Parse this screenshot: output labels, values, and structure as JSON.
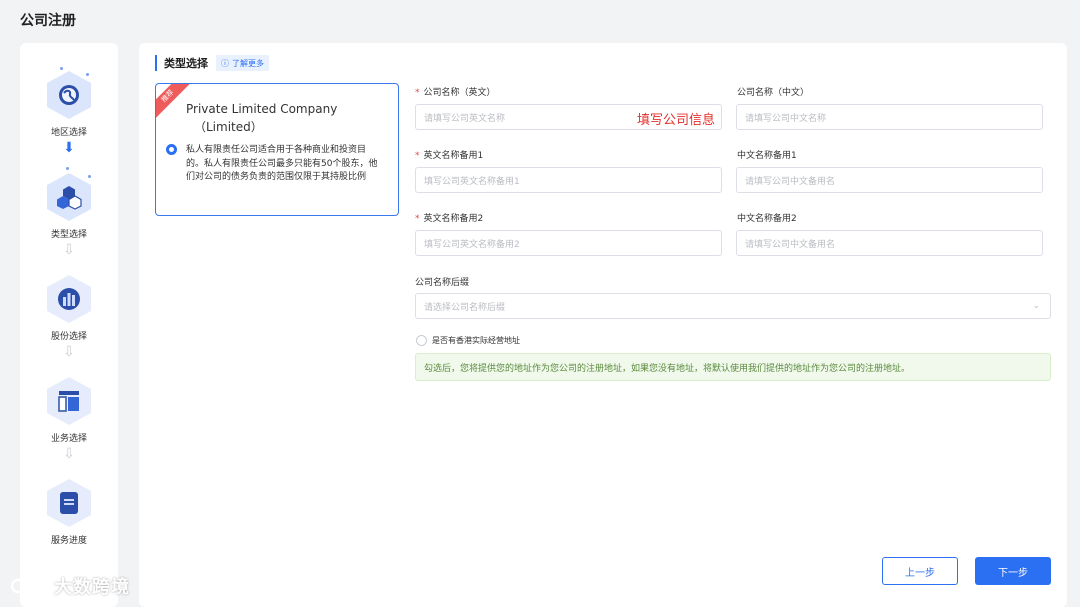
{
  "page_title": "公司注册",
  "steps": [
    {
      "label": "地区选择",
      "icon": "globe-icon",
      "state": "done"
    },
    {
      "label": "类型选择",
      "icon": "cubes-icon",
      "state": "active"
    },
    {
      "label": "股份选择",
      "icon": "bar-chart-icon",
      "state": "pending"
    },
    {
      "label": "业务选择",
      "icon": "layout-icon",
      "state": "pending"
    },
    {
      "label": "服务进度",
      "icon": "document-icon",
      "state": "pending"
    }
  ],
  "section": {
    "title": "类型选择",
    "learn_more": "了解更多"
  },
  "company_type": {
    "badge": "推荐",
    "title": "Private Limited Company",
    "subtitle": "（Limited）",
    "description": "私人有限责任公司适合用于各种商业和投资目的。私人有限责任公司最多只能有50个股东，他们对公司的债务负责的范围仅限于其持股比例",
    "selected": true
  },
  "form": {
    "name_en": {
      "label": "公司名称（英文）",
      "required": true,
      "placeholder": "请填写公司英文名称",
      "annotation": "填写公司信息"
    },
    "name_cn": {
      "label": "公司名称（中文）",
      "required": false,
      "placeholder": "请填写公司中文名称"
    },
    "alt_en_1": {
      "label": "英文名称备用1",
      "required": true,
      "placeholder": "填写公司英文名称备用1"
    },
    "alt_cn_1": {
      "label": "中文名称备用1",
      "required": false,
      "placeholder": "请填写公司中文备用名"
    },
    "alt_en_2": {
      "label": "英文名称备用2",
      "required": true,
      "placeholder": "填写公司英文名称备用2"
    },
    "alt_cn_2": {
      "label": "中文名称备用2",
      "required": false,
      "placeholder": "请填写公司中文备用名"
    },
    "suffix": {
      "label": "公司名称后缀",
      "placeholder": "请选择公司名称后缀"
    },
    "hk_address": {
      "label": "是否有香港实际经营地址",
      "checked": false
    },
    "note": "勾选后，您将提供您的地址作为您公司的注册地址，如果您没有地址，将默认使用我们提供的地址作为您公司的注册地址。"
  },
  "buttons": {
    "prev": "上一步",
    "next": "下一步"
  },
  "watermark": "大数跨境",
  "colors": {
    "primary": "#2b6ff2",
    "required": "#e54545",
    "annotation": "#e5302b",
    "note_bg": "#f0f9eb"
  }
}
